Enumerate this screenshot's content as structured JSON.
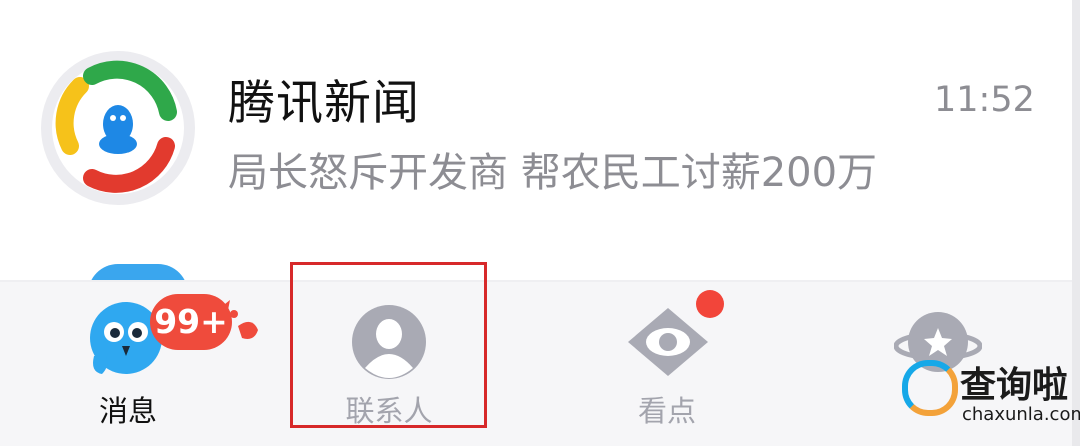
{
  "chat": {
    "title": "腾讯新闻",
    "time": "11:52",
    "preview": "局长怒斥开发商 帮农民工讨薪200万",
    "avatar_icon": "tencent-news-logo-icon"
  },
  "tabs": [
    {
      "label": "消息",
      "icon": "qq-penguin-icon",
      "badge": "99+"
    },
    {
      "label": "联系人",
      "icon": "contacts-person-icon"
    },
    {
      "label": "看点",
      "icon": "eye-icon"
    },
    {
      "label": "",
      "icon": "planet-star-icon"
    }
  ],
  "watermark": {
    "title": "查询啦",
    "url": "chaxunla.com"
  },
  "colors": {
    "highlight": "#d7292a",
    "badge": "#ef4b3c",
    "inactive_tab": "#a3a4ad",
    "accent_blue": "#3aa6ee"
  }
}
